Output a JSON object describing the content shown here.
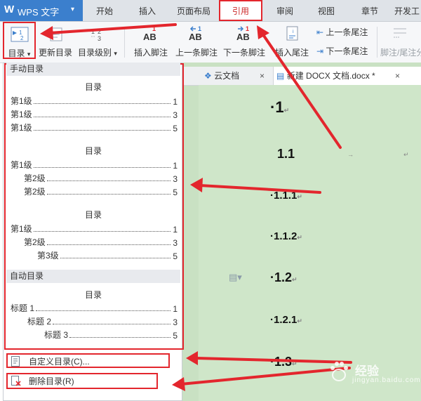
{
  "app": {
    "name": "WPS 文字"
  },
  "tabs": [
    {
      "label": "开始"
    },
    {
      "label": "插入"
    },
    {
      "label": "页面布局"
    },
    {
      "label": "引用",
      "active": true
    },
    {
      "label": "审阅"
    },
    {
      "label": "视图"
    },
    {
      "label": "章节"
    },
    {
      "label": "开发工"
    }
  ],
  "ribbon": {
    "toc_button": "目录",
    "update_toc": "更新目录",
    "toc_level": "目录级别",
    "insert_footnote": "插入脚注",
    "prev_footnote": "上一条脚注",
    "next_footnote": "下一条脚注",
    "insert_endnote": "插入尾注",
    "prev_endnote": "上一条尾注",
    "next_endnote": "下一条尾注",
    "footnote_endnote": "脚注/尾注分"
  },
  "panel": {
    "manual_section": "手动目录",
    "auto_section": "自动目录",
    "toc_title": "目录",
    "manual_1": [
      {
        "label": "第1级",
        "page": "1"
      },
      {
        "label": "第1级",
        "page": "3"
      },
      {
        "label": "第1级",
        "page": "5"
      }
    ],
    "manual_2": [
      {
        "label": "第1级",
        "page": "1"
      },
      {
        "label": "第2级",
        "page": "3"
      },
      {
        "label": "第2级",
        "page": "5"
      }
    ],
    "manual_3": [
      {
        "label": "第1级",
        "page": "1"
      },
      {
        "label": "第2级",
        "page": "3"
      },
      {
        "label": "第3级",
        "page": "5"
      }
    ],
    "auto_1": [
      {
        "label": "标题 1",
        "page": "1"
      },
      {
        "label": "标题 2",
        "page": "3"
      },
      {
        "label": "标题 3",
        "page": "5"
      }
    ],
    "custom_toc": "自定义目录(C)...",
    "delete_toc": "删除目录(R)"
  },
  "doc_tabs": {
    "cloud": "云文档",
    "doc": "新建 DOCX 文档.docx *"
  },
  "document": {
    "headings": [
      "1",
      "1.1",
      "1.1.1",
      "1.1.2",
      "1.2",
      "1.2.1",
      "1.3"
    ]
  },
  "watermark": {
    "cn": "经验",
    "en": "jingyan.baidu.com"
  },
  "colors": {
    "accent": "#3b7fcd",
    "annotation": "#e3262d",
    "doc_bg": "#c9e1c3"
  }
}
